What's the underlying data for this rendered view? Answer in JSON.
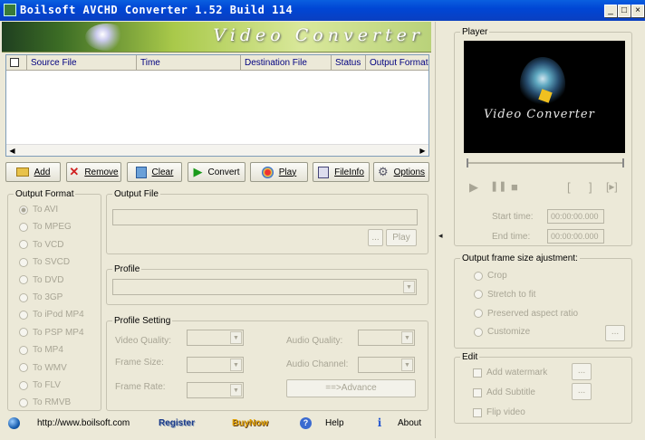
{
  "window": {
    "title": "Boilsoft AVCHD Converter 1.52 Build 114",
    "min": "_",
    "max": "□",
    "close": "×"
  },
  "banner": {
    "text": "Video Converter"
  },
  "filelist": {
    "columns": [
      "Source File",
      "Time",
      "Destination File",
      "Status",
      "Output Format"
    ],
    "rows": []
  },
  "toolbar": {
    "add": "Add",
    "remove": "Remove",
    "clear": "Clear",
    "convert": "Convert",
    "play": "Play",
    "fileinfo": "FileInfo",
    "options": "Options"
  },
  "output_format": {
    "label": "Output Format",
    "options": [
      "To AVI",
      "To MPEG",
      "To VCD",
      "To SVCD",
      "To DVD",
      "To 3GP",
      "To iPod MP4",
      "To PSP MP4",
      "To MP4",
      "To WMV",
      "To FLV",
      "To RMVB"
    ],
    "selected": "To AVI"
  },
  "output_file": {
    "label": "Output File",
    "value": "",
    "browse": "...",
    "play": "Play"
  },
  "profile": {
    "label": "Profile",
    "value": ""
  },
  "profile_setting": {
    "label": "Profile Setting",
    "video_quality": "Video Quality:",
    "frame_size": "Frame Size:",
    "frame_rate": "Frame Rate:",
    "audio_quality": "Audio Quality:",
    "audio_channel": "Audio Channel:",
    "advance": "==>Advance"
  },
  "player": {
    "label": "Player",
    "video_text": "Video Converter",
    "start_time_label": "Start time:",
    "start_time": "00:00:00.000",
    "end_time_label": "End  time:",
    "end_time": "00:00:00.000"
  },
  "frame_size": {
    "label": "Output frame size ajustment:",
    "options": [
      "Crop",
      "Stretch to fit",
      "Preserved aspect ratio",
      "Customize"
    ],
    "custom_btn": "..."
  },
  "edit": {
    "label": "Edit",
    "add_watermark": "Add watermark",
    "add_subtitle": "Add Subtitle",
    "flip_video": "Flip video",
    "btn": "..."
  },
  "footer": {
    "url": "http://www.boilsoft.com",
    "register": "Register",
    "buynow": "BuyNow",
    "help": "Help",
    "about": "About"
  },
  "collapse_arrow": "◂"
}
